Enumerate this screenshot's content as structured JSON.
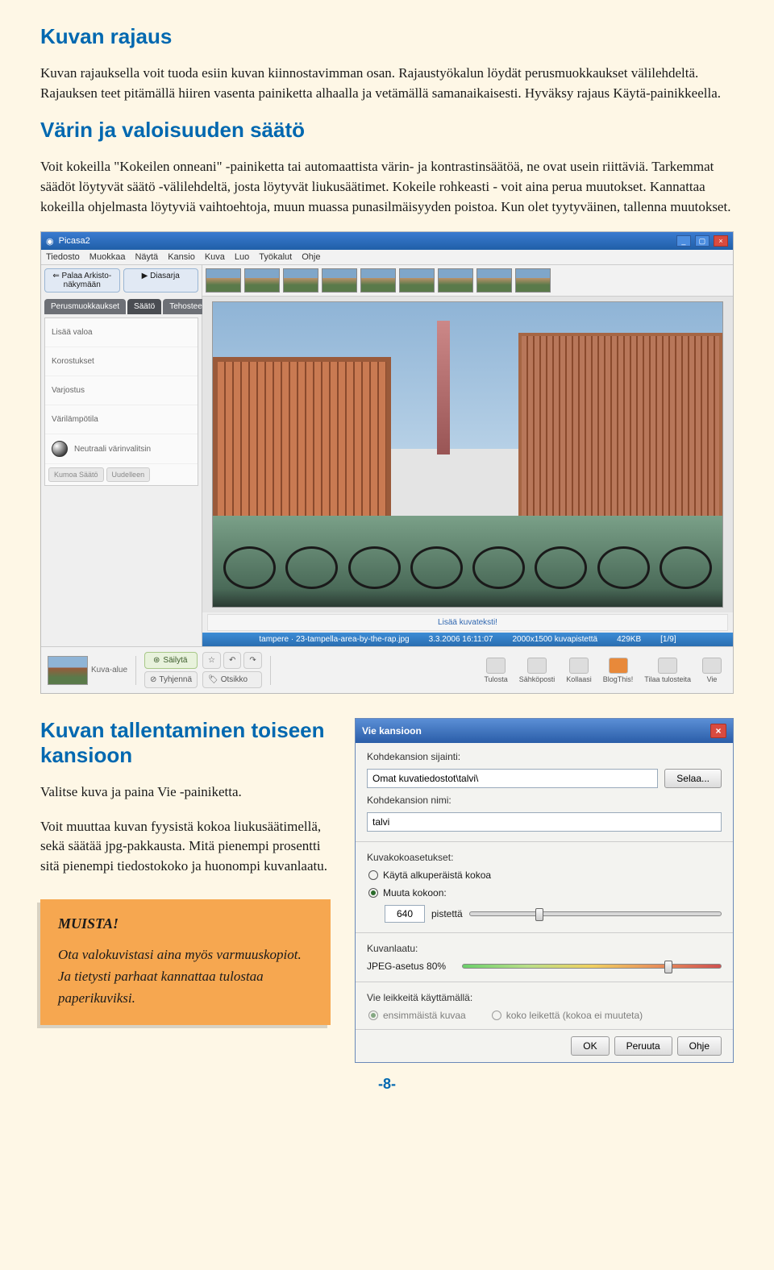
{
  "section1": {
    "title": "Kuvan rajaus",
    "body": "Kuvan rajauksella voit tuoda esiin kuvan kiinnostavimman osan. Rajaustyökalun löydät perusmuokkaukset välilehdeltä. Rajauksen teet pitämällä hiiren vasenta painiketta alhaalla ja vetämällä samanaikaisesti. Hyväksy rajaus Käytä-painikkeella."
  },
  "section2": {
    "title": "Värin ja valoisuuden säätö",
    "body": "Voit kokeilla \"Kokeilen onneani\" -painiketta tai automaattista värin- ja kontrastinsäätöä, ne ovat usein riittäviä. Tarkemmat säädöt löytyvät säätö -välilehdeltä, josta löytyvät liukusäätimet. Kokeile rohkeasti - voit aina perua muutokset. Kannattaa kokeilla ohjelmasta löytyviä vaihtoehtoja, muun muassa punasilmäisyyden poistoa. Kun olet tyytyväinen, tallenna muutokset."
  },
  "app": {
    "title": "Picasa2",
    "menu": [
      "Tiedosto",
      "Muokkaa",
      "Näytä",
      "Kansio",
      "Kuva",
      "Luo",
      "Työkalut",
      "Ohje"
    ],
    "back_btn": "Palaa Arkisto-näkymään",
    "slideshow_btn": "Diasarja",
    "tabs": [
      "Perusmuokkaukset",
      "Säätö",
      "Tehosteet"
    ],
    "tool_items": [
      "Lisää valoa",
      "Korostukset",
      "Varjostus",
      "Värilämpötila",
      "Neutraali värinvalitsin"
    ],
    "undo": "Kumoa Säätö",
    "redo": "Uudelleen",
    "caption_link": "Lisää kuvateksti!",
    "info_filename": "tampere · 23-tampella-area-by-the-rap.jpg",
    "info_date": "3.3.2006 16:11:07",
    "info_size": "2000x1500 kuvapistettä",
    "info_bytes": "429KB",
    "info_index": "[1/9]",
    "bt_kuvaalue": "Kuva-alue",
    "bt_sailyta": "Säilytä",
    "bt_tyhjenna": "Tyhjennä",
    "bt_otsikko": "Otsikko",
    "exports": [
      "Tulosta",
      "Sähköposti",
      "Kollaasi",
      "BlogThis!",
      "Tilaa tulosteita",
      "Vie"
    ]
  },
  "section3": {
    "title": "Kuvan tallentaminen toiseen kansioon",
    "p1": "Valitse kuva ja paina Vie -painiketta.",
    "p2": "Voit muuttaa kuvan fyysistä kokoa liukusäätimellä, sekä säätää jpg-pakkausta. Mitä pienempi prosentti sitä pienempi tiedostokoko ja huonompi kuvanlaatu."
  },
  "dialog": {
    "title": "Vie kansioon",
    "loc_label": "Kohdekansion sijainti:",
    "loc_value": "Omat kuvatiedostot\\talvi\\",
    "browse": "Selaa...",
    "name_label": "Kohdekansion nimi:",
    "name_value": "talvi",
    "size_label": "Kuvakokoasetukset:",
    "radio1": "Käytä alkuperäistä kokoa",
    "radio2": "Muuta kokoon:",
    "px_value": "640",
    "px_unit": "pistettä",
    "quality_label": "Kuvanlaatu:",
    "quality_value": "JPEG-asetus 80%",
    "export_label": "Vie leikkeitä käyttämällä:",
    "export_r1": "ensimmäistä kuvaa",
    "export_r2": "koko leikettä (kokoa ei muuteta)",
    "ok": "OK",
    "cancel": "Peruuta",
    "help": "Ohje"
  },
  "callout": {
    "title": "MUISTA!",
    "body": "Ota valokuvistasi aina myös varmuuskopiot. Ja tietysti parhaat kannattaa tulostaa paperikuviksi."
  },
  "page_number": "-8-"
}
